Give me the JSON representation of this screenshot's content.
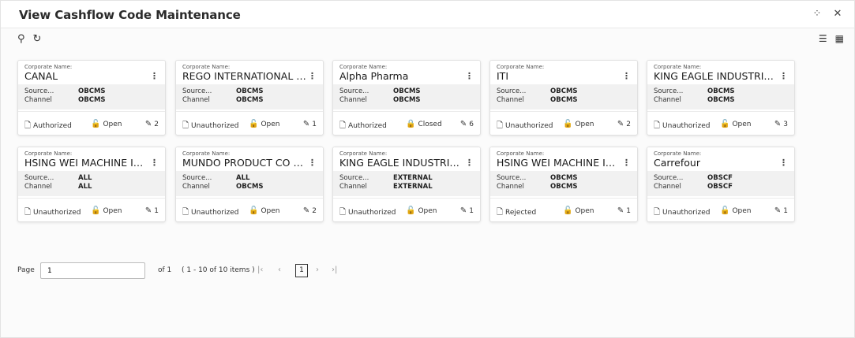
{
  "header": {
    "title": "View Cashflow Code Maintenance",
    "icons": [
      "collapse-icon",
      "close-icon"
    ]
  },
  "toolbar": {
    "left_icons": [
      "search-icon",
      "refresh-icon"
    ],
    "right_icons": [
      "list-view-icon",
      "grid-view-icon"
    ]
  },
  "card_labels": {
    "name_label": "Corporate Name:",
    "source_label": "Source...",
    "channel_label": "Channel"
  },
  "cards": [
    {
      "name": "CANAL",
      "source": "OBCMS",
      "channel": "OBCMS",
      "status": "Authorized",
      "lock": "Open",
      "edits": "2"
    },
    {
      "name": "REGO INTERNATIONAL C...",
      "source": "OBCMS",
      "channel": "OBCMS",
      "status": "Unauthorized",
      "lock": "Open",
      "edits": "1"
    },
    {
      "name": "Alpha Pharma",
      "source": "OBCMS",
      "channel": "OBCMS",
      "status": "Authorized",
      "lock": "Closed",
      "edits": "6"
    },
    {
      "name": "ITI",
      "source": "OBCMS",
      "channel": "OBCMS",
      "status": "Unauthorized",
      "lock": "Open",
      "edits": "2"
    },
    {
      "name": "KING EAGLE INDUSTRIAL ...",
      "source": "OBCMS",
      "channel": "OBCMS",
      "status": "Unauthorized",
      "lock": "Open",
      "edits": "3"
    },
    {
      "name": "HSING WEI MACHINE IND...",
      "source": "ALL",
      "channel": "ALL",
      "status": "Unauthorized",
      "lock": "Open",
      "edits": "1"
    },
    {
      "name": "MUNDO PRODUCT CO LTD",
      "source": "ALL",
      "channel": "OBCMS",
      "status": "Unauthorized",
      "lock": "Open",
      "edits": "2"
    },
    {
      "name": "KING EAGLE INDUSTRIAL ...",
      "source": "EXTERNAL",
      "channel": "EXTERNAL",
      "status": "Unauthorized",
      "lock": "Open",
      "edits": "1"
    },
    {
      "name": "HSING WEI MACHINE IND...",
      "source": "OBCMS",
      "channel": "OBCMS",
      "status": "Rejected",
      "lock": "Open",
      "edits": "1"
    },
    {
      "name": "Carrefour",
      "source": "OBSCF",
      "channel": "OBSCF",
      "status": "Unauthorized",
      "lock": "Open",
      "edits": "1"
    }
  ],
  "pagination": {
    "page_label": "Page",
    "page_value": "1",
    "of_label": "of 1",
    "info": "( 1 - 10 of 10 items )",
    "current_page": "1"
  }
}
